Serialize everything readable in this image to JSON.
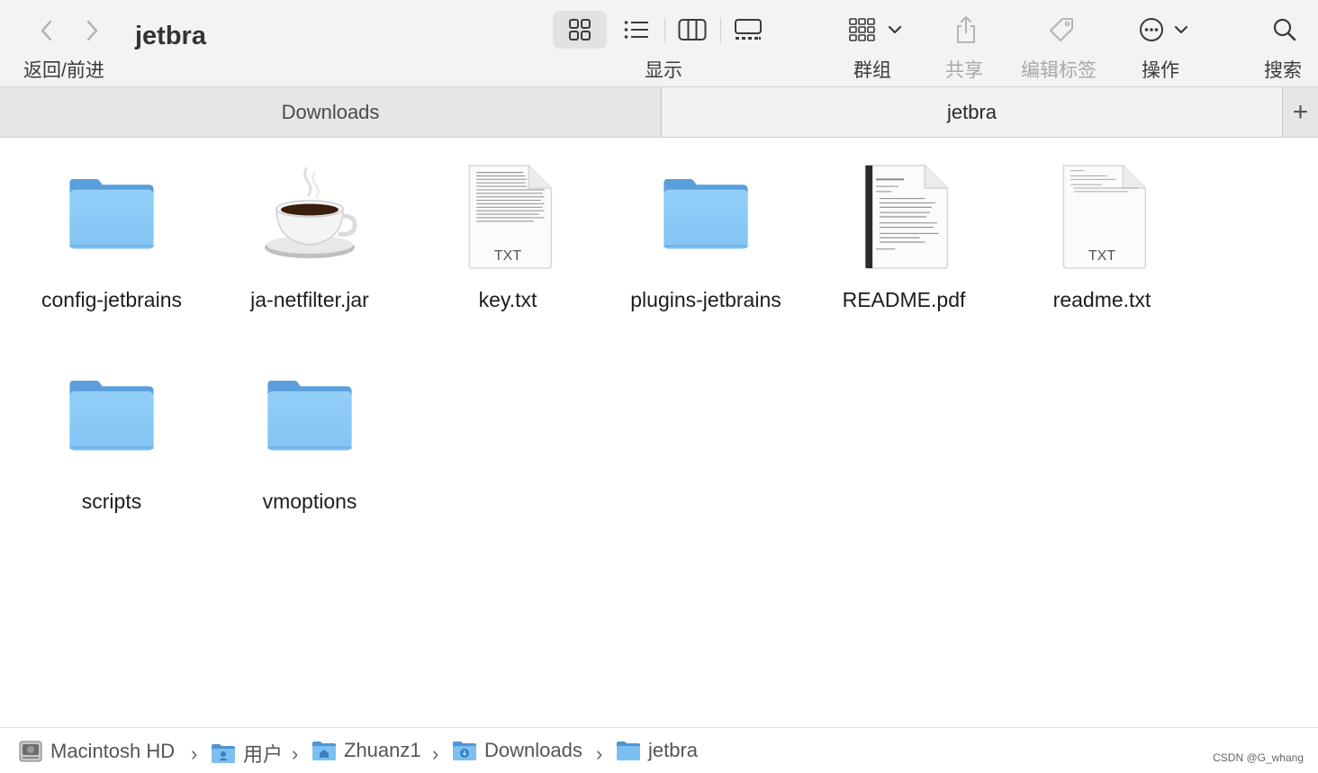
{
  "window": {
    "title": "jetbra"
  },
  "toolbar": {
    "back_forward_label": "返回/前进",
    "view_label": "显示",
    "group_label": "群组",
    "share_label": "共享",
    "tags_label": "编辑标签",
    "action_label": "操作",
    "search_label": "搜索",
    "selected_view": "icon-view"
  },
  "tabs": [
    {
      "label": "Downloads",
      "active": false
    },
    {
      "label": "jetbra",
      "active": true
    }
  ],
  "tab_add_label": "+",
  "items": [
    {
      "name": "config-jetbrains",
      "kind": "folder"
    },
    {
      "name": "ja-netfilter.jar",
      "kind": "java-jar"
    },
    {
      "name": "key.txt",
      "kind": "txt",
      "badge": "TXT"
    },
    {
      "name": "plugins-jetbrains",
      "kind": "folder"
    },
    {
      "name": "README.pdf",
      "kind": "pdf"
    },
    {
      "name": "readme.txt",
      "kind": "txt",
      "badge": "TXT"
    },
    {
      "name": "scripts",
      "kind": "folder"
    },
    {
      "name": "vmoptions",
      "kind": "folder"
    }
  ],
  "pathbar": [
    {
      "label": "Macintosh HD",
      "icon": "hard-drive-icon"
    },
    {
      "label": "用户",
      "icon": "users-folder-icon"
    },
    {
      "label": "Zhuanz1",
      "icon": "home-folder-icon"
    },
    {
      "label": "Downloads",
      "icon": "downloads-folder-icon"
    },
    {
      "label": "jetbra",
      "icon": "folder-icon"
    }
  ],
  "watermark": "CSDN @G_whang",
  "colors": {
    "folder": "#8ccbf6",
    "folder_dark": "#5fa8e3",
    "accent": "#1e73c8"
  }
}
